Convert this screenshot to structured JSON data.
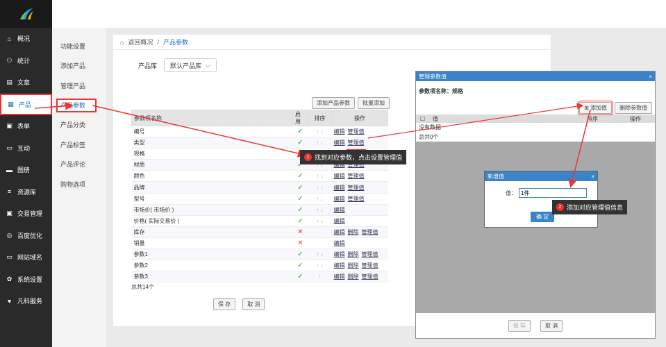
{
  "sidebar": {
    "items": [
      {
        "icon": "⌂",
        "label": "概况"
      },
      {
        "icon": "⚇",
        "label": "统计"
      },
      {
        "icon": "▤",
        "label": "文章"
      },
      {
        "icon": "▦",
        "label": "产品"
      },
      {
        "icon": "▣",
        "label": "表单"
      },
      {
        "icon": "▭",
        "label": "互动"
      },
      {
        "icon": "▬",
        "label": "图册"
      },
      {
        "icon": "≡",
        "label": "资源库"
      },
      {
        "icon": "▣",
        "label": "交易管理"
      },
      {
        "icon": "◎",
        "label": "百度优化"
      },
      {
        "icon": "▭",
        "label": "网站域名"
      },
      {
        "icon": "✿",
        "label": "系统设置"
      },
      {
        "icon": "♥",
        "label": "凡科服务"
      }
    ]
  },
  "subnav": [
    "功能设置",
    "添加产品",
    "管理产品",
    "产品参数",
    "产品分类",
    "产品标签",
    "产品评论",
    "购物选项"
  ],
  "breadcrumb": {
    "back": "返回概况",
    "sep": "/",
    "current": "产品参数"
  },
  "filter": {
    "label": "产品库",
    "value": "默认产品库"
  },
  "toolbar": {
    "add_param": "添加产品参数",
    "batch_add": "批量添加"
  },
  "table": {
    "headers": [
      "参数项名称",
      "启用",
      "排序",
      "操作"
    ],
    "rows": [
      {
        "name": "编号",
        "enabled": true,
        "sort": "↑ ↓",
        "ops": [
          "编辑",
          "管理值"
        ]
      },
      {
        "name": "类型",
        "enabled": true,
        "sort": "↑ ↓",
        "ops": [
          "编辑",
          "管理值"
        ]
      },
      {
        "name": "规格",
        "enabled": true,
        "sort": "↑ ↓",
        "ops": [
          "编辑",
          "管理值"
        ]
      },
      {
        "name": "材质",
        "enabled": true,
        "sort": "↑ ↓",
        "ops": [
          "编辑",
          "管理值"
        ]
      },
      {
        "name": "颜色",
        "enabled": true,
        "sort": "↑ ↓",
        "ops": [
          "编辑",
          "管理值"
        ]
      },
      {
        "name": "品牌",
        "enabled": true,
        "sort": "↑ ↓",
        "ops": [
          "编辑",
          "管理值"
        ]
      },
      {
        "name": "型号",
        "enabled": true,
        "sort": "↑ ↓",
        "ops": [
          "编辑",
          "管理值"
        ]
      },
      {
        "name": "市场价( 市场价 )",
        "enabled": true,
        "sort": "↑ ↓",
        "ops": [
          "编辑"
        ]
      },
      {
        "name": "价格( 实际交易价 )",
        "enabled": true,
        "sort": "↑ ↓",
        "ops": [
          "编辑"
        ]
      },
      {
        "name": "库存",
        "enabled": false,
        "sort": "",
        "ops": [
          "编辑",
          "删除",
          "管理值"
        ]
      },
      {
        "name": "销量",
        "enabled": false,
        "sort": "",
        "ops": [
          "编辑"
        ]
      },
      {
        "name": "参数1",
        "enabled": true,
        "sort": "↑ ↓",
        "ops": [
          "编辑",
          "删除",
          "管理值"
        ]
      },
      {
        "name": "参数2",
        "enabled": true,
        "sort": "↑ ↓",
        "ops": [
          "编辑",
          "删除",
          "管理值"
        ]
      },
      {
        "name": "参数3",
        "enabled": true,
        "sort": "↑",
        "ops": [
          "编辑",
          "删除",
          "管理值"
        ]
      }
    ],
    "total": "总共14个"
  },
  "footer": {
    "save": "保 存",
    "cancel": "取 消"
  },
  "dialog": {
    "title": "管理参数值",
    "close": "×",
    "name_label": "参数项名称：规格",
    "add_value": "添加值",
    "delete_value": "删除参数值",
    "col_value": "值",
    "col_sort": "排序",
    "col_ops": "操作",
    "empty": "没有数据",
    "total": "总共0个",
    "save": "保 存",
    "cancel": "取 消"
  },
  "subdialog": {
    "title": "新增值",
    "close": "×",
    "label": "值：",
    "value": "1件",
    "confirm": "确 定"
  },
  "tips": [
    {
      "num": "1",
      "text": "找到对应参数，点击设置管理值"
    },
    {
      "num": "2",
      "text": "添加对应管理值信息"
    }
  ],
  "colors": {
    "accent": "#3a83c9",
    "highlight": "#e33333",
    "sidebar": "#2a2a2a"
  }
}
